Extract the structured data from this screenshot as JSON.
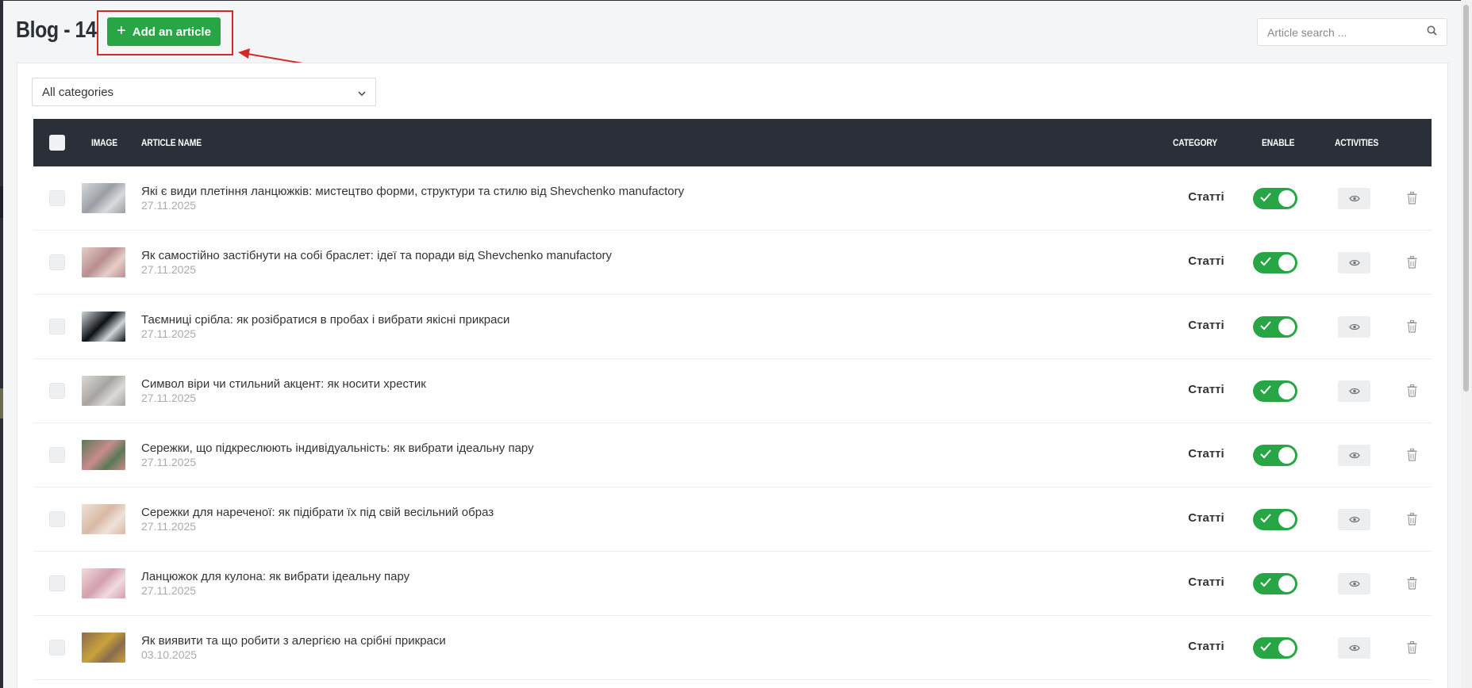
{
  "header": {
    "title": "Blog - 14",
    "add_button_label": "Add an article",
    "search_placeholder": "Article search ..."
  },
  "filter": {
    "category_selected": "All categories"
  },
  "table": {
    "columns": {
      "image": "IMAGE",
      "article_name": "ARTICLE NAME",
      "category": "CATEGORY",
      "enable": "ENABLE",
      "activities": "ACTIVITIES"
    },
    "rows": [
      {
        "title": "Які є види плетіння ланцюжків: мистецтво форми, структури та стилю від Shevchenko manufactory",
        "date": "27.11.2025",
        "category": "Статті",
        "enabled": true,
        "thumb_colors": [
          "#9a9ea3",
          "#d8dadc"
        ]
      },
      {
        "title": "Як самостійно застібнути на собі браслет: ідеї та поради від Shevchenko manufactory",
        "date": "27.11.2025",
        "category": "Статті",
        "enabled": true,
        "thumb_colors": [
          "#b98d8f",
          "#e6cfc9"
        ]
      },
      {
        "title": "Таємниці срібла: як розібратися в пробах і вибрати якісні прикраси",
        "date": "27.11.2025",
        "category": "Статті",
        "enabled": true,
        "thumb_colors": [
          "#0e1113",
          "#cfd6da"
        ]
      },
      {
        "title": "Символ віри чи стильний акцент: як носити хрестик",
        "date": "27.11.2025",
        "category": "Статті",
        "enabled": true,
        "thumb_colors": [
          "#a7a4a1",
          "#dcd9d5"
        ]
      },
      {
        "title": "Сережки, що підкреслюють індивідуальність: як вибрати ідеальну пару",
        "date": "27.11.2025",
        "category": "Статті",
        "enabled": true,
        "thumb_colors": [
          "#c98a8d",
          "#5b7a55"
        ]
      },
      {
        "title": "Сережки для нареченої: як підібрати їх під свій весільний образ",
        "date": "27.11.2025",
        "category": "Статті",
        "enabled": true,
        "thumb_colors": [
          "#d9b8a6",
          "#efe2d8"
        ]
      },
      {
        "title": "Ланцюжок для кулона: як вибрати ідеальну пару",
        "date": "27.11.2025",
        "category": "Статті",
        "enabled": true,
        "thumb_colors": [
          "#d39fab",
          "#f1dbe0"
        ]
      },
      {
        "title": "Як виявити та що робити з алергією на срібні прикраси",
        "date": "03.10.2025",
        "category": "Статті",
        "enabled": true,
        "thumb_colors": [
          "#c9a23a",
          "#8a6b4f"
        ]
      }
    ]
  },
  "colors": {
    "accent_green": "#28a645",
    "table_header": "#2a2f38",
    "annotation_red": "#d22a2a"
  },
  "icons": {
    "search": "search-icon",
    "chevron": "chevron-down-icon",
    "view": "eye-icon",
    "delete": "trash-icon",
    "check": "check-icon"
  }
}
